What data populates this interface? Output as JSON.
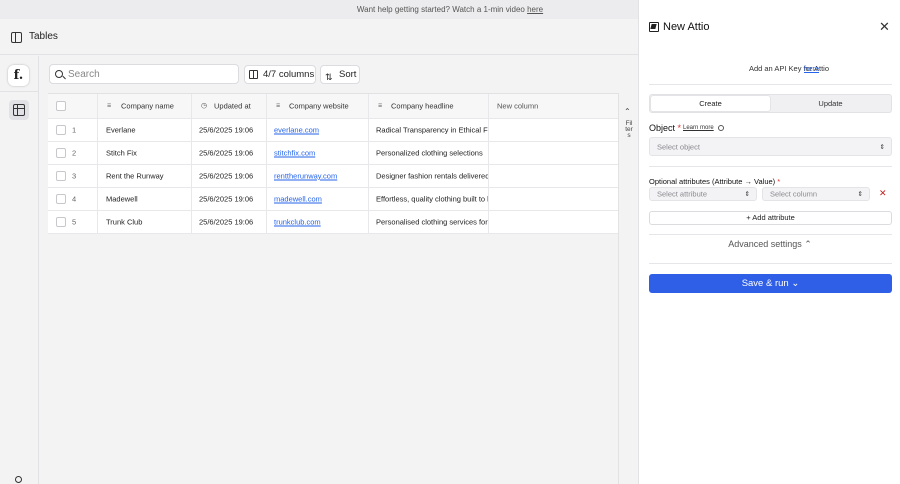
{
  "topbar": {
    "text": "Want help getting started? Watch a 1-min video",
    "link": "here"
  },
  "header": {
    "title": "Tables"
  },
  "nav": {
    "logo": "f."
  },
  "toolbar": {
    "search_placeholder": "Search",
    "columns_label": "4/7 columns",
    "sort_label": "Sort"
  },
  "table": {
    "columns": [
      "Company name",
      "Updated at",
      "Company website",
      "Company headline",
      "New column"
    ],
    "rows": [
      {
        "num": "1",
        "name": "Everlane",
        "updated": "25/6/2025 19:06",
        "website": "everlane.com",
        "headline": "Radical Transparency in Ethical Fashion"
      },
      {
        "num": "2",
        "name": "Stitch Fix",
        "updated": "25/6/2025 19:06",
        "website": "stitchfix.com",
        "headline": "Personalized clothing selections"
      },
      {
        "num": "3",
        "name": "Rent the Runway",
        "updated": "25/6/2025 19:06",
        "website": "renttherunway.com",
        "headline": "Designer fashion rentals delivered"
      },
      {
        "num": "4",
        "name": "Madewell",
        "updated": "25/6/2025 19:06",
        "website": "madewell.com",
        "headline": "Effortless, quality clothing built to last"
      },
      {
        "num": "5",
        "name": "Trunk Club",
        "updated": "25/6/2025 19:06",
        "website": "trunkclub.com",
        "headline": "Personalised clothing services for men"
      }
    ]
  },
  "filters": {
    "label": "Filters"
  },
  "panel": {
    "title": "New Attio",
    "api_text": "Add an API Key for Attio",
    "api_link": "here",
    "tabs": [
      "Create",
      "Update"
    ],
    "object_label": "Object",
    "learn_more": "Learn more",
    "object_placeholder": "Select object",
    "optional_label": "Optional attributes (Attribute → Value)",
    "attribute_placeholder": "Select attribute",
    "column_placeholder": "Select column",
    "add_attribute": "Add attribute",
    "advanced": "Advanced settings",
    "save": "Save & run"
  }
}
